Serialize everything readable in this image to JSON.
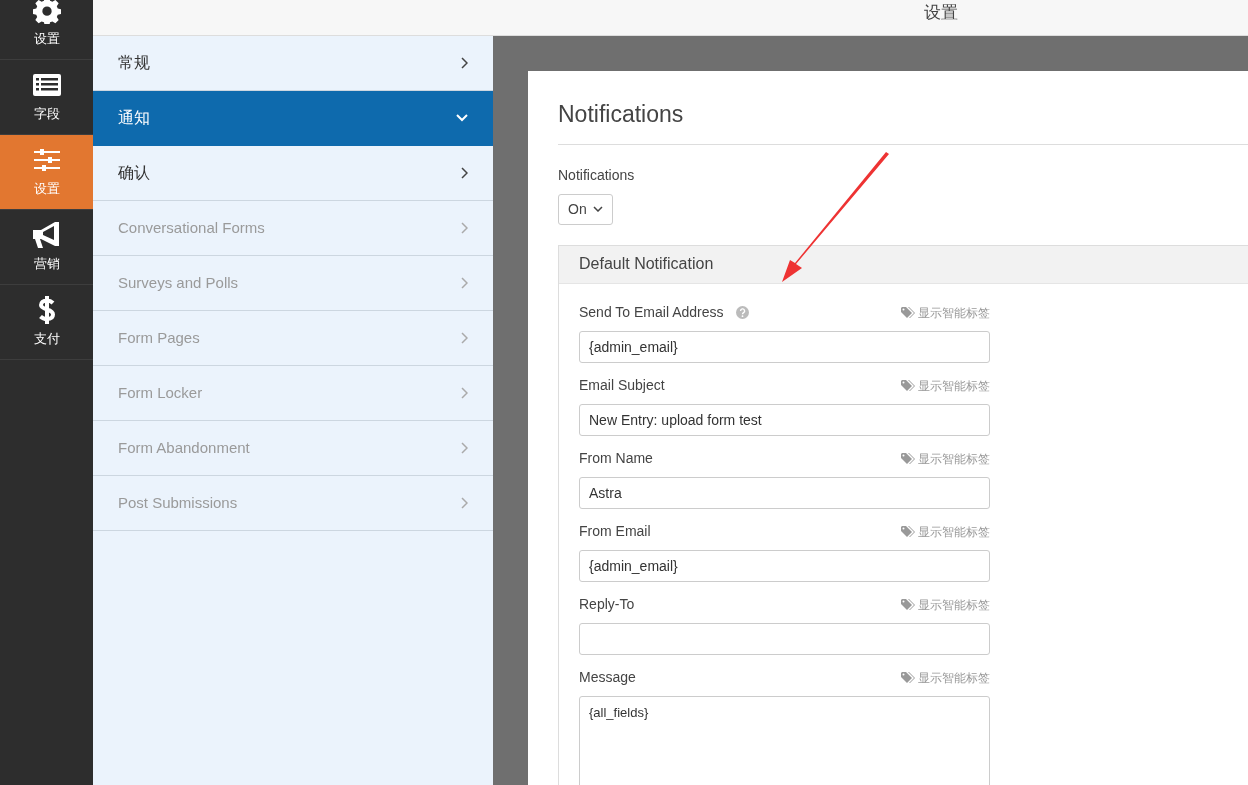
{
  "header": {
    "title": "设置"
  },
  "rail": [
    {
      "label": "设置",
      "kind": "gear",
      "selected": false
    },
    {
      "label": "字段",
      "kind": "list",
      "selected": false
    },
    {
      "label": "设置",
      "kind": "sliders",
      "selected": true
    },
    {
      "label": "营销",
      "kind": "megaphone",
      "selected": false
    },
    {
      "label": "支付",
      "kind": "dollar",
      "selected": false
    }
  ],
  "sections": [
    {
      "label": "常规",
      "selected": false,
      "disabled": false
    },
    {
      "label": "通知",
      "selected": true,
      "disabled": false
    },
    {
      "label": "确认",
      "selected": false,
      "disabled": false
    },
    {
      "label": "Conversational Forms",
      "selected": false,
      "disabled": true
    },
    {
      "label": "Surveys and Polls",
      "selected": false,
      "disabled": true
    },
    {
      "label": "Form Pages",
      "selected": false,
      "disabled": true
    },
    {
      "label": "Form Locker",
      "selected": false,
      "disabled": true
    },
    {
      "label": "Form Abandonment",
      "selected": false,
      "disabled": true
    },
    {
      "label": "Post Submissions",
      "selected": false,
      "disabled": true
    }
  ],
  "panel": {
    "title": "Notifications",
    "toggle_label": "Notifications",
    "toggle_value": "On",
    "notification": {
      "title": "Default Notification",
      "fields": [
        {
          "kind": "input",
          "label": "Send To Email Address",
          "help": true,
          "smart_tags": "显示智能标签",
          "value": "{admin_email}"
        },
        {
          "kind": "input",
          "label": "Email Subject",
          "help": false,
          "smart_tags": "显示智能标签",
          "value": "New Entry: upload form test"
        },
        {
          "kind": "input",
          "label": "From Name",
          "help": false,
          "smart_tags": "显示智能标签",
          "value": "Astra"
        },
        {
          "kind": "input",
          "label": "From Email",
          "help": false,
          "smart_tags": "显示智能标签",
          "value": "{admin_email}"
        },
        {
          "kind": "input",
          "label": "Reply-To",
          "help": false,
          "smart_tags": "显示智能标签"
        },
        {
          "kind": "textarea",
          "label": "Message",
          "help": false,
          "smart_tags": "显示智能标签",
          "value": "{all_fields}"
        }
      ]
    }
  }
}
